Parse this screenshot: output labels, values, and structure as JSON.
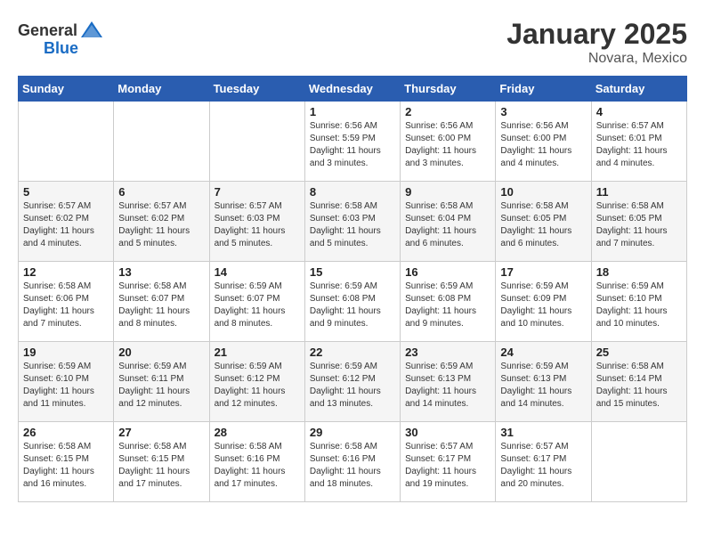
{
  "logo": {
    "general": "General",
    "blue": "Blue"
  },
  "title": "January 2025",
  "location": "Novara, Mexico",
  "days_of_week": [
    "Sunday",
    "Monday",
    "Tuesday",
    "Wednesday",
    "Thursday",
    "Friday",
    "Saturday"
  ],
  "weeks": [
    [
      {
        "day": "",
        "info": ""
      },
      {
        "day": "",
        "info": ""
      },
      {
        "day": "",
        "info": ""
      },
      {
        "day": "1",
        "info": "Sunrise: 6:56 AM\nSunset: 5:59 PM\nDaylight: 11 hours and 3 minutes."
      },
      {
        "day": "2",
        "info": "Sunrise: 6:56 AM\nSunset: 6:00 PM\nDaylight: 11 hours and 3 minutes."
      },
      {
        "day": "3",
        "info": "Sunrise: 6:56 AM\nSunset: 6:00 PM\nDaylight: 11 hours and 4 minutes."
      },
      {
        "day": "4",
        "info": "Sunrise: 6:57 AM\nSunset: 6:01 PM\nDaylight: 11 hours and 4 minutes."
      }
    ],
    [
      {
        "day": "5",
        "info": "Sunrise: 6:57 AM\nSunset: 6:02 PM\nDaylight: 11 hours and 4 minutes."
      },
      {
        "day": "6",
        "info": "Sunrise: 6:57 AM\nSunset: 6:02 PM\nDaylight: 11 hours and 5 minutes."
      },
      {
        "day": "7",
        "info": "Sunrise: 6:57 AM\nSunset: 6:03 PM\nDaylight: 11 hours and 5 minutes."
      },
      {
        "day": "8",
        "info": "Sunrise: 6:58 AM\nSunset: 6:03 PM\nDaylight: 11 hours and 5 minutes."
      },
      {
        "day": "9",
        "info": "Sunrise: 6:58 AM\nSunset: 6:04 PM\nDaylight: 11 hours and 6 minutes."
      },
      {
        "day": "10",
        "info": "Sunrise: 6:58 AM\nSunset: 6:05 PM\nDaylight: 11 hours and 6 minutes."
      },
      {
        "day": "11",
        "info": "Sunrise: 6:58 AM\nSunset: 6:05 PM\nDaylight: 11 hours and 7 minutes."
      }
    ],
    [
      {
        "day": "12",
        "info": "Sunrise: 6:58 AM\nSunset: 6:06 PM\nDaylight: 11 hours and 7 minutes."
      },
      {
        "day": "13",
        "info": "Sunrise: 6:58 AM\nSunset: 6:07 PM\nDaylight: 11 hours and 8 minutes."
      },
      {
        "day": "14",
        "info": "Sunrise: 6:59 AM\nSunset: 6:07 PM\nDaylight: 11 hours and 8 minutes."
      },
      {
        "day": "15",
        "info": "Sunrise: 6:59 AM\nSunset: 6:08 PM\nDaylight: 11 hours and 9 minutes."
      },
      {
        "day": "16",
        "info": "Sunrise: 6:59 AM\nSunset: 6:08 PM\nDaylight: 11 hours and 9 minutes."
      },
      {
        "day": "17",
        "info": "Sunrise: 6:59 AM\nSunset: 6:09 PM\nDaylight: 11 hours and 10 minutes."
      },
      {
        "day": "18",
        "info": "Sunrise: 6:59 AM\nSunset: 6:10 PM\nDaylight: 11 hours and 10 minutes."
      }
    ],
    [
      {
        "day": "19",
        "info": "Sunrise: 6:59 AM\nSunset: 6:10 PM\nDaylight: 11 hours and 11 minutes."
      },
      {
        "day": "20",
        "info": "Sunrise: 6:59 AM\nSunset: 6:11 PM\nDaylight: 11 hours and 12 minutes."
      },
      {
        "day": "21",
        "info": "Sunrise: 6:59 AM\nSunset: 6:12 PM\nDaylight: 11 hours and 12 minutes."
      },
      {
        "day": "22",
        "info": "Sunrise: 6:59 AM\nSunset: 6:12 PM\nDaylight: 11 hours and 13 minutes."
      },
      {
        "day": "23",
        "info": "Sunrise: 6:59 AM\nSunset: 6:13 PM\nDaylight: 11 hours and 14 minutes."
      },
      {
        "day": "24",
        "info": "Sunrise: 6:59 AM\nSunset: 6:13 PM\nDaylight: 11 hours and 14 minutes."
      },
      {
        "day": "25",
        "info": "Sunrise: 6:58 AM\nSunset: 6:14 PM\nDaylight: 11 hours and 15 minutes."
      }
    ],
    [
      {
        "day": "26",
        "info": "Sunrise: 6:58 AM\nSunset: 6:15 PM\nDaylight: 11 hours and 16 minutes."
      },
      {
        "day": "27",
        "info": "Sunrise: 6:58 AM\nSunset: 6:15 PM\nDaylight: 11 hours and 17 minutes."
      },
      {
        "day": "28",
        "info": "Sunrise: 6:58 AM\nSunset: 6:16 PM\nDaylight: 11 hours and 17 minutes."
      },
      {
        "day": "29",
        "info": "Sunrise: 6:58 AM\nSunset: 6:16 PM\nDaylight: 11 hours and 18 minutes."
      },
      {
        "day": "30",
        "info": "Sunrise: 6:57 AM\nSunset: 6:17 PM\nDaylight: 11 hours and 19 minutes."
      },
      {
        "day": "31",
        "info": "Sunrise: 6:57 AM\nSunset: 6:17 PM\nDaylight: 11 hours and 20 minutes."
      },
      {
        "day": "",
        "info": ""
      }
    ]
  ]
}
